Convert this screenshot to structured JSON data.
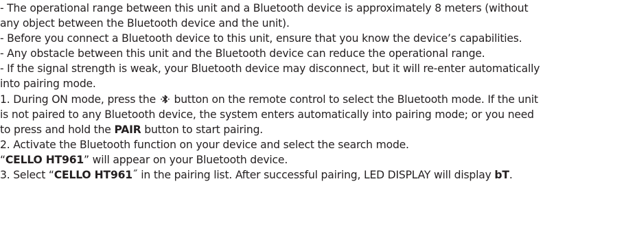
{
  "notes": [
    {
      "lines": [
        "- The operational range between this unit and a Bluetooth device is approximately 8 meters (without",
        "any object between the Bluetooth device and the unit)."
      ]
    },
    {
      "lines": [
        "- Before you connect a Bluetooth device to this unit, ensure that you know the device’s capabilities."
      ]
    },
    {
      "lines": [
        "- Any obstacle between this unit and the Bluetooth device can reduce the operational range."
      ]
    },
    {
      "lines": [
        "- If the signal strength is weak, your Bluetooth device may disconnect, but it will re-enter automatically",
        "into pairing mode."
      ]
    }
  ],
  "steps": {
    "step1": {
      "line1_before_icon": "1. During ON mode, press the ",
      "line1_after_icon": " button on the remote control to select the Bluetooth mode. If the  unit",
      "line2": " is not paired to any Bluetooth device, the system enters automatically into pairing  mode; or you need",
      "line3_before": "to press and hold the ",
      "line3_bold": "PAIR",
      "line3_after": " button to start pairing.",
      "icon": "bluetooth-icon"
    },
    "step2": {
      "line1": "2. Activate the Bluetooth function on your device and select the search mode.",
      "line2_open_quote": "“",
      "line2_bold": "CELLO HT961",
      "line2_after": "” will appear on your Bluetooth device."
    },
    "step3": {
      "before": "3. Select “",
      "bold_name": "CELLO HT961",
      "middle": "˝ in the pairing list. After successful pairing, LED DISPLAY will display ",
      "bold_display": "bT",
      "end": "."
    }
  }
}
